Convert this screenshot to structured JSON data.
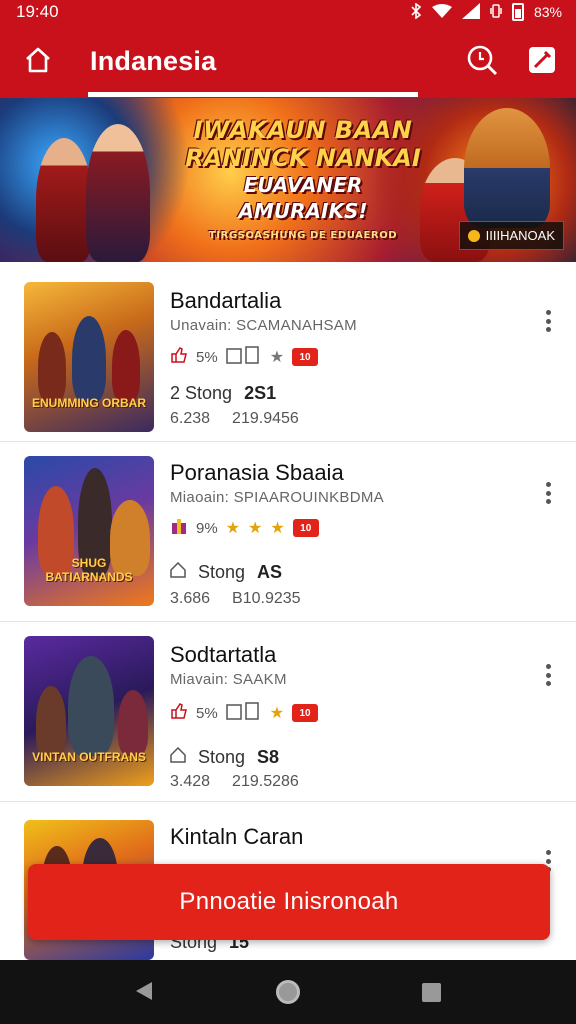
{
  "status_bar": {
    "time": "19:40",
    "battery": "83%"
  },
  "app_bar": {
    "title": "Indanesia",
    "icons": [
      "home-icon",
      "search-icon",
      "edit-icon"
    ]
  },
  "banner": {
    "line1": "IWAKAUN BAAN",
    "line2": "RANINCK NANKAI",
    "line3": "EUAVANER AMURAIKS!",
    "line4": "TIRGSOASHUNG DE EDUAEROD",
    "badge": "IIIIHANOAK"
  },
  "items": [
    {
      "title": "Bandartalia",
      "subtitle": "Unavain: SCAMANAHSAM",
      "meta_percent": "5%",
      "tag": "10",
      "stat_label": "2 Stong",
      "stat_value": "2S1",
      "num1": "6.238",
      "num2": "219.9456",
      "thumb_caption": "ENUMMING ORBAR"
    },
    {
      "title": "Poranasia Sbaaia",
      "subtitle": "Miaoain: SPIAAROUINKBDMA",
      "meta_percent": "9%",
      "tag": "10",
      "stat_label": "Stong",
      "stat_value": "AS",
      "num1": "3.686",
      "num2": "B10.9235",
      "thumb_caption": "SHUG BATIARNANDS"
    },
    {
      "title": "Sodtartatla",
      "subtitle": "Miavain: SAAKM",
      "meta_percent": "5%",
      "tag": "10",
      "stat_label": "Stong",
      "stat_value": "S8",
      "num1": "3.428",
      "num2": "219.5286",
      "thumb_caption": "VINTAN OUTFRANS"
    },
    {
      "title": "Kintaln Caran",
      "subtitle": "",
      "meta_percent": "",
      "tag": "",
      "stat_label": "Stong",
      "stat_value": "15",
      "num1": "",
      "num2": "",
      "thumb_caption": ""
    }
  ],
  "cta": {
    "label": "Pnnoatie Inisronoah"
  },
  "colors": {
    "brand_red": "#c8111a",
    "cta_red": "#e2231a",
    "star_gold": "#e2a40a"
  }
}
